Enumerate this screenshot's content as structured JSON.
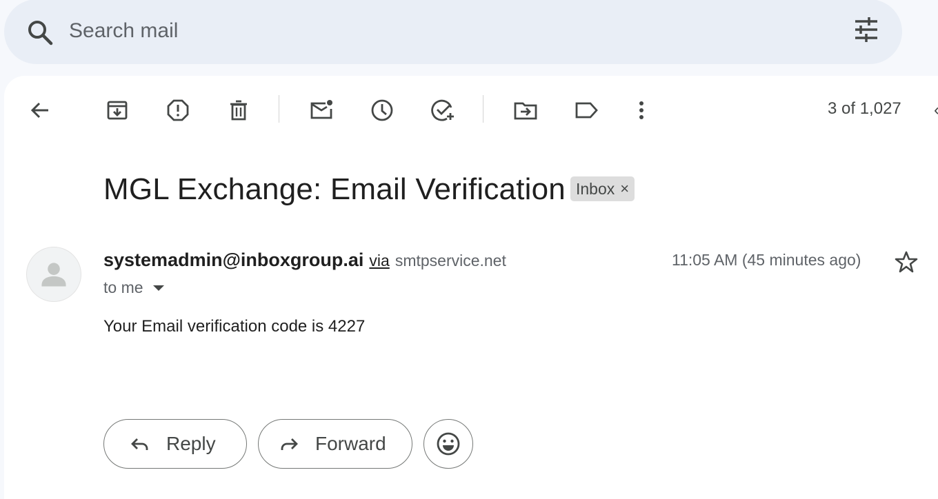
{
  "search": {
    "placeholder": "Search mail",
    "search_icon": "search-icon",
    "filter_icon": "tune-icon"
  },
  "toolbar": {
    "icons": [
      "back-arrow-icon",
      "archive-icon",
      "report-spam-icon",
      "delete-icon",
      "mark-unread-icon",
      "snooze-icon",
      "add-to-tasks-icon",
      "move-to-icon",
      "label-icon",
      "more-vert-icon"
    ],
    "page_count": "3 of 1,027"
  },
  "message": {
    "subject": "MGL Exchange: Email Verification",
    "label": "Inbox",
    "label_remove": "×",
    "sender": "systemadmin@inboxgroup.ai",
    "via_text": "via",
    "via_domain": "smtpservice.net",
    "recipient": "to me",
    "timestamp": "11:05 AM (45 minutes ago)",
    "body": "Your Email verification code is 4227"
  },
  "actions": {
    "reply": "Reply",
    "forward": "Forward"
  },
  "colors": {
    "background": "#f6f8fc",
    "search_bg": "#e9eef6",
    "panel_bg": "#ffffff",
    "chip_bg": "#dddddd"
  }
}
